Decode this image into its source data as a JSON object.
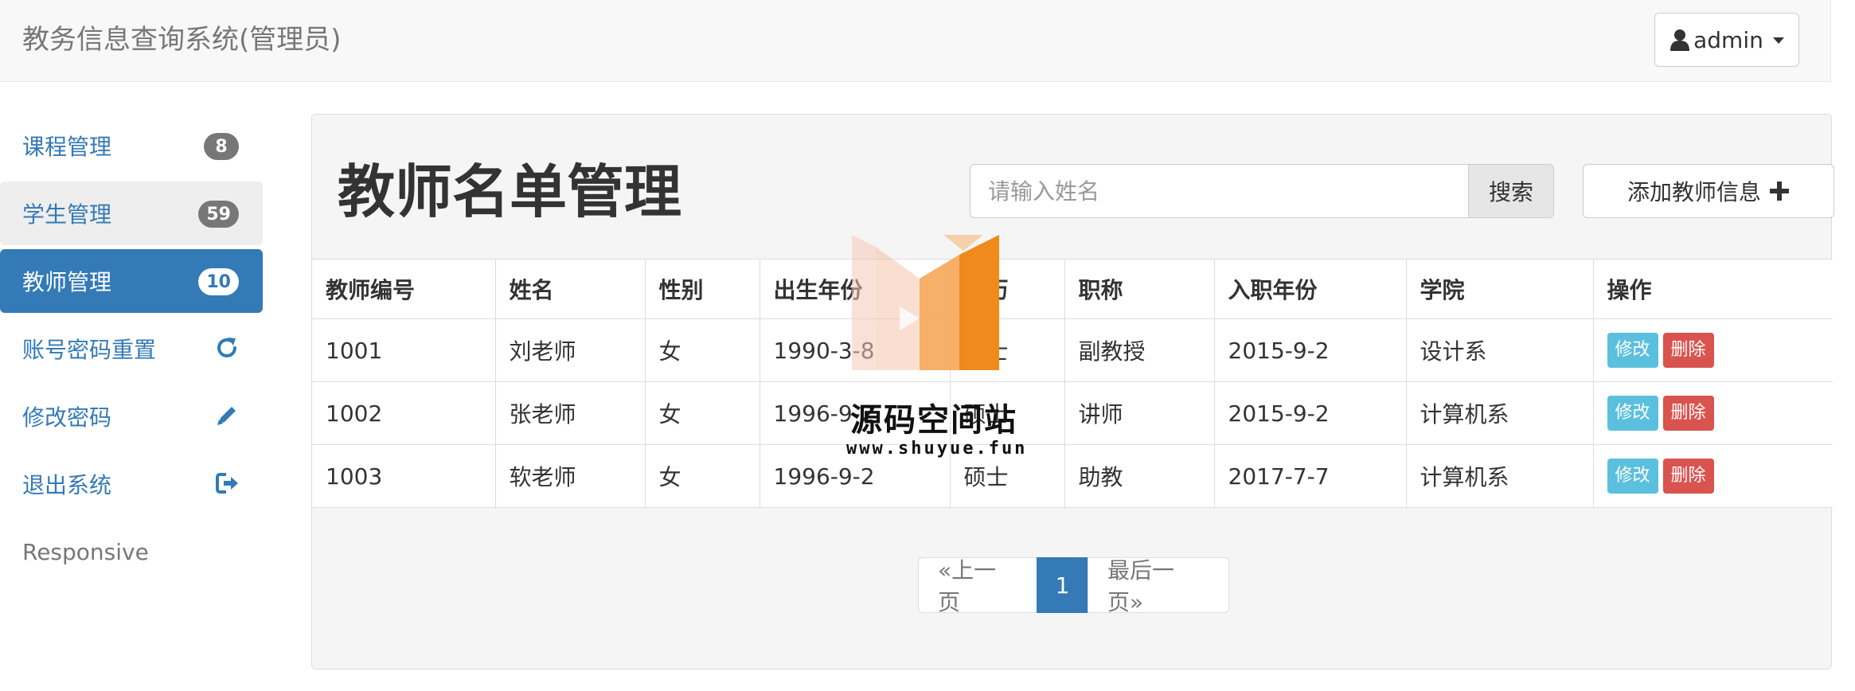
{
  "navbar": {
    "brand": "教务信息查询系统(管理员)",
    "user_label": "admin"
  },
  "sidebar": {
    "items": [
      {
        "label": "课程管理",
        "badge": "8",
        "icon": ""
      },
      {
        "label": "学生管理",
        "badge": "59",
        "icon": ""
      },
      {
        "label": "教师管理",
        "badge": "10",
        "icon": ""
      },
      {
        "label": "账号密码重置",
        "badge": "",
        "icon": "refresh-icon"
      },
      {
        "label": "修改密码",
        "badge": "",
        "icon": "pencil-icon"
      },
      {
        "label": "退出系统",
        "badge": "",
        "icon": "logout-icon"
      }
    ],
    "footer_text": "Responsive"
  },
  "main": {
    "title": "教师名单管理",
    "search_placeholder": "请输入姓名",
    "search_button": "搜索",
    "add_button": "添加教师信息"
  },
  "table": {
    "headers": [
      "教师编号",
      "姓名",
      "性别",
      "出生年份",
      "学历",
      "职称",
      "入职年份",
      "学院",
      "操作"
    ],
    "rows": [
      [
        "1001",
        "刘老师",
        "女",
        "1990-3-8",
        "硕士",
        "副教授",
        "2015-9-2",
        "设计系"
      ],
      [
        "1002",
        "张老师",
        "女",
        "1996-9-2",
        "硕士",
        "讲师",
        "2015-9-2",
        "计算机系"
      ],
      [
        "1003",
        "软老师",
        "女",
        "1996-9-2",
        "硕士",
        "助教",
        "2017-7-7",
        "计算机系"
      ]
    ],
    "edit_label": "修改",
    "delete_label": "删除"
  },
  "pagination": {
    "prev": "«上一页",
    "current": "1",
    "last": "最后一页»"
  },
  "watermark": {
    "title": "源码空间站",
    "url": "www.shuyue.fun"
  },
  "colors": {
    "primary": "#337ab7",
    "info": "#5bc0de",
    "danger": "#d9534f",
    "watermark_orange": "#f08a1c"
  }
}
